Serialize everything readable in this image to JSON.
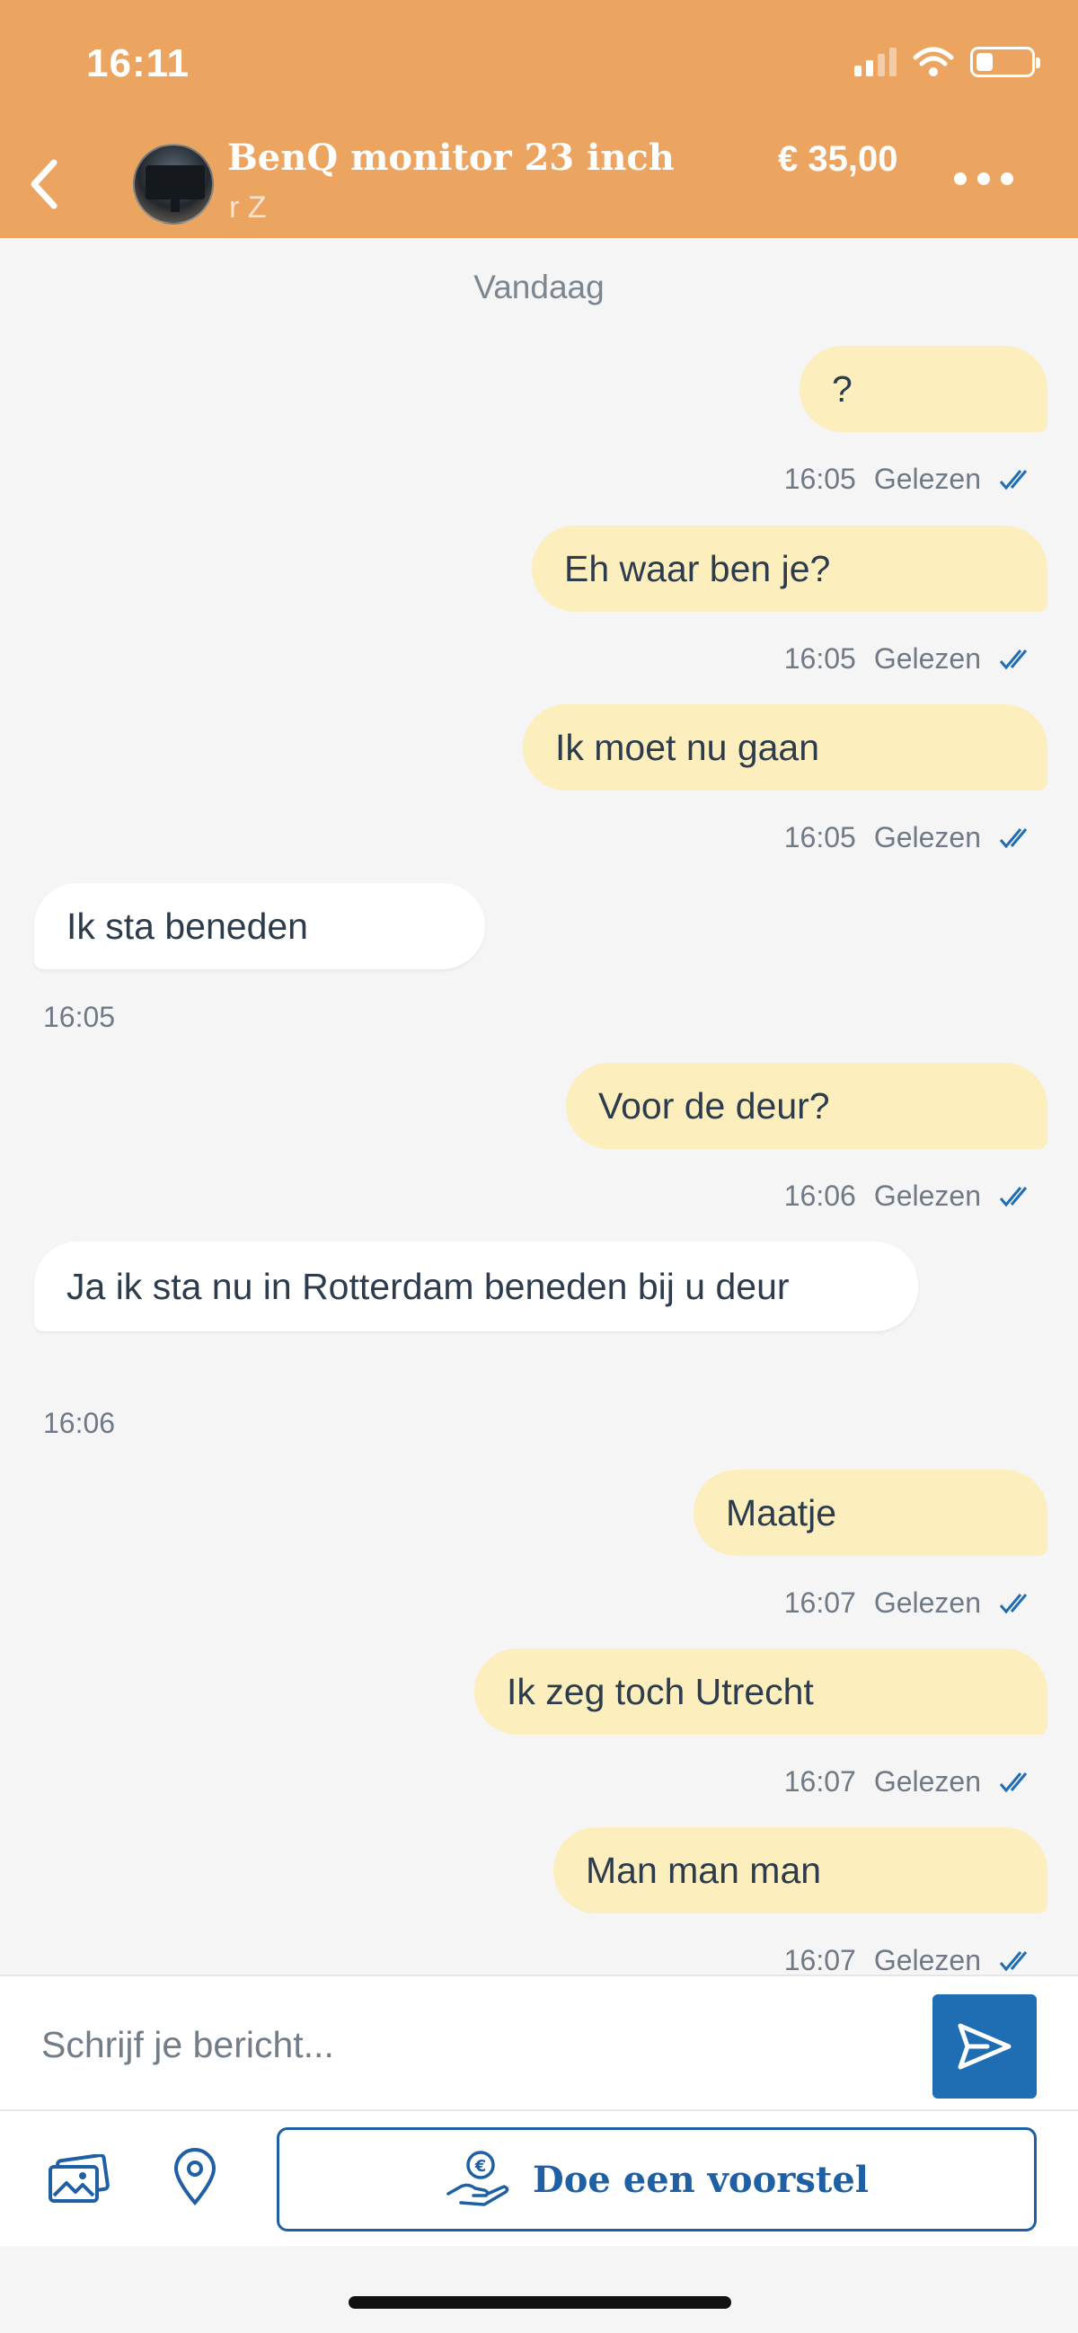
{
  "status_bar": {
    "time": "16:11",
    "icons": [
      "signal-icon",
      "wifi-icon",
      "battery-icon"
    ]
  },
  "header": {
    "back_icon": "chevron-left-icon",
    "item_title": "BenQ monitor 23 inch",
    "user_name": "r Z",
    "price": "€ 35,00",
    "more_icon": "more-horizontal-icon"
  },
  "chat": {
    "day_label": "Vandaag",
    "messages": [
      {
        "direction": "sent",
        "text": "?",
        "time": "16:05",
        "status": "Gelezen"
      },
      {
        "direction": "sent",
        "text": "Eh waar ben je?",
        "time": "16:05",
        "status": "Gelezen"
      },
      {
        "direction": "sent",
        "text": "Ik moet nu gaan",
        "time": "16:05",
        "status": "Gelezen"
      },
      {
        "direction": "received",
        "text": "Ik sta beneden",
        "time": "16:05"
      },
      {
        "direction": "sent",
        "text": "Voor de deur?",
        "time": "16:06",
        "status": "Gelezen"
      },
      {
        "direction": "received",
        "text": "Ja ik sta nu in Rotterdam beneden bij u deur",
        "time": "16:06"
      },
      {
        "direction": "sent",
        "text": "Maatje",
        "time": "16:07",
        "status": "Gelezen"
      },
      {
        "direction": "sent",
        "text": "Ik zeg toch Utrecht",
        "time": "16:07",
        "status": "Gelezen"
      },
      {
        "direction": "sent",
        "text": "Man man man",
        "time": "16:07",
        "status": "Gelezen"
      }
    ]
  },
  "composer": {
    "placeholder": "Schrijf je bericht...",
    "value": "",
    "send_icon": "send-icon"
  },
  "toolbar": {
    "photo_icon": "photo-gallery-icon",
    "location_icon": "location-pin-icon",
    "offer_icon": "euro-hand-icon",
    "offer_label": "Doe een voorstel"
  },
  "colors": {
    "header_bg": "#eca461",
    "sent_bubble": "#fdeebe",
    "received_bubble": "#ffffff",
    "chat_bg": "#f5f5f5",
    "accent_blue": "#1f6db3"
  }
}
